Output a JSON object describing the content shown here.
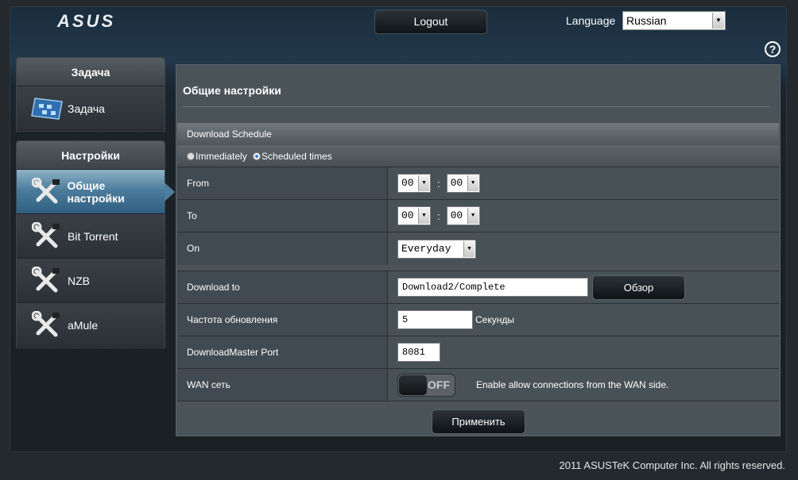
{
  "header": {
    "logo": "ASUS",
    "logout_label": "Logout",
    "language_label": "Language",
    "language_value": "Russian"
  },
  "sidebar": {
    "task_section": {
      "title": "Задача",
      "items": [
        {
          "label": "Задача",
          "icon": "task-dashboard-icon"
        }
      ]
    },
    "settings_section": {
      "title": "Настройки",
      "items": [
        {
          "label": "Общие настройки",
          "icon": "tools-icon",
          "active": true
        },
        {
          "label": "Bit Torrent",
          "icon": "tools-icon"
        },
        {
          "label": "NZB",
          "icon": "tools-icon"
        },
        {
          "label": "aMule",
          "icon": "tools-icon"
        }
      ]
    }
  },
  "main": {
    "title": "Общие настройки",
    "schedule": {
      "title": "Download Schedule",
      "immediately_label": "Immediately",
      "scheduled_label": "Scheduled times",
      "selected": "scheduled",
      "from_label": "From",
      "from_hour": "00",
      "from_min": "00",
      "to_label": "To",
      "to_hour": "00",
      "to_min": "00",
      "on_label": "On",
      "on_value": "Everyday"
    },
    "download_to": {
      "label": "Download to",
      "value": "Download2/Complete",
      "browse_label": "Обзор"
    },
    "refresh": {
      "label": "Частота обновления",
      "value": "5",
      "unit": "Секунды"
    },
    "port": {
      "label": "DownloadMaster Port",
      "value": "8081"
    },
    "wan": {
      "label": "WAN сеть",
      "toggle_text": "OFF",
      "description": "Enable allow connections from the WAN side."
    },
    "apply_label": "Применить"
  },
  "footer": {
    "copyright": "2011 ASUSTeK Computer Inc. All rights reserved."
  },
  "colors": {
    "active_item": "#4d7d9c",
    "panel_bg": "#4a5358",
    "page_bg": "#23292d"
  }
}
